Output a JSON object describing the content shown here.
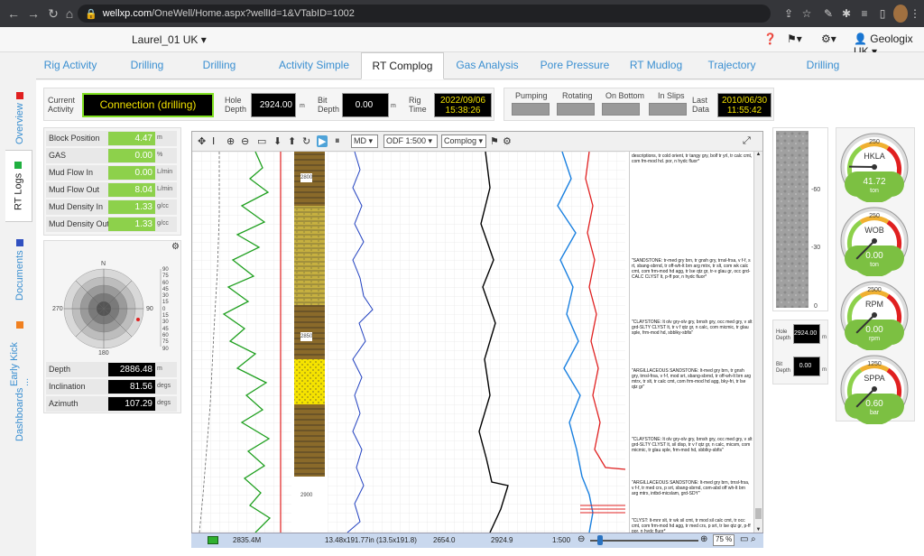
{
  "browser": {
    "url_host": "wellxp.com",
    "url_path": "/OneWell/Home.aspx?wellId=1&VTabID=1002"
  },
  "app": {
    "well_name": "Laurel_01 UK",
    "user": "Geologix UK"
  },
  "tabs": [
    "Rig Activity",
    "Drilling",
    "Drilling Activity",
    "Activity Simple",
    "RT Complog",
    "Gas Analysis",
    "Pore Pressure",
    "RT Mudlog",
    "Trajectory",
    "Drilling Advanced"
  ],
  "active_tab": "RT Complog",
  "sidebar": [
    "Overview",
    "RT Logs",
    "Documents",
    "Early Kick ...",
    "Dashboards"
  ],
  "sidebar_colors": [
    "#e02020",
    "#20b040",
    "#3050c0",
    "#f08020",
    ""
  ],
  "activity": {
    "current_label": "Current Activity",
    "current_value": "Connection (drilling)",
    "hole_depth_label": "Hole Depth",
    "hole_depth": "2924.00",
    "hole_unit": "m",
    "bit_depth_label": "Bit Depth",
    "bit_depth": "0.00",
    "bit_unit": "m",
    "rig_time_label": "Rig Time",
    "rig_date": "2022/09/06",
    "rig_clock": "15:38:26"
  },
  "status_flags": {
    "pumping": "Pumping",
    "rotating": "Rotating",
    "on_bottom": "On Bottom",
    "in_slips": "In Slips",
    "last_data_label": "Last Data",
    "last_date": "2010/06/30",
    "last_clock": "11:55:42"
  },
  "params": [
    {
      "name": "Block Position",
      "value": "4.47",
      "unit": "m"
    },
    {
      "name": "GAS",
      "value": "0.00",
      "unit": "%"
    },
    {
      "name": "Mud Flow In",
      "value": "0.00",
      "unit": "L/min"
    },
    {
      "name": "Mud Flow Out",
      "value": "8.04",
      "unit": "L/min"
    },
    {
      "name": "Mud Density In",
      "value": "1.33",
      "unit": "g/cc"
    },
    {
      "name": "Mud Density Out",
      "value": "1.33",
      "unit": "g/cc"
    }
  ],
  "compass": {
    "n": "N",
    "e": "90",
    "s": "180",
    "w": "270",
    "scale": [
      "90",
      "75",
      "60",
      "45",
      "30",
      "15",
      "0",
      "15",
      "30",
      "45",
      "60",
      "75",
      "90"
    ]
  },
  "direction": [
    {
      "name": "Depth",
      "value": "2886.48",
      "unit": "m"
    },
    {
      "name": "Inclination",
      "value": "81.56",
      "unit": "degs"
    },
    {
      "name": "Azimuth",
      "value": "107.29",
      "unit": "degs"
    }
  ],
  "log_toolbar": {
    "index": "MD",
    "scale": "ODF 1:500",
    "template": "Complog"
  },
  "depth_marks": [
    "2800",
    "2850",
    "2900"
  ],
  "lithology_notes": [
    "descriptions, tr cold orient, tr tangy gry, bolf tr yrl, tr calc cmt, com fm-mod hd. por, n hydc fluor*",
    "\"SANDSTONE: tr-med gry brn, tr gnsh gry, trnsl-frsa, v f-f, s rt, sbang-sbrnd, tr off-wh-lt brn arg mtrx, tr slt, com wk calc cmt, com frm-mod hd agg, tr lse qtz gr, tr-v glau gr, occ grd-CALC CLYST lt, p-ff por, n hydc fluor*",
    "\"CLAYSTONE: lt olv gry-olv gry, brnsh gry, occ med gry, v slt grd-SLTY CLYST lt, tr v f qtz gr, n calc, com micmic, tr glau sple, frm-mod hd, sbblky-sbfis\"",
    "\"ARGILLACEOUS SANDSTONE: lt-med gry brn, tr gnsh gry, trnsl-frsa, v f-f, mod srt, sbang-sbrnd, tr off-wh-lt brn arg mtrx, tr slt, tr calc cmt, com frm-mod hd agg, bky-fri, tr lse qtz gr\"",
    "\"CLAYSTONE: lt olv gry-olv gry, brnsh gry, occ med gry, v slt grd-SLTY CLYST lt, sil disp, tr v f qtz gr, n calc, micsm, com micmic, tr glau sple, frm-mod hd, sbblky-sbfis\"",
    "\"ARGILLACEOUS SANDSTONE: lt-med gry brn, trnsl-frsa, v f-f, tr med crs, p srt, sbang-sbrnd, com-abd off wh-lt brn arg mtrx, intbd-micslam, grd-SDY\"",
    "\"CLYST: lt-mnr slt, tr wk sil cmt, tr mod sil calc cmt, tr occ cmt, com frm-mod hd agg, tr med crs, p srt, tr lse qtz gr, p-ff por, n hydc fluor*"
  ],
  "image_scale": [
    "-60",
    "-30",
    "0"
  ],
  "mini_depth": {
    "hole_label": "Hole Depth",
    "hole": "2924.00",
    "hole_unit": "m",
    "bit_label": "Bit Depth",
    "bit": "0.00",
    "bit_unit": "m"
  },
  "gauges": [
    {
      "name": "HKLA",
      "max": "250",
      "value": "41.72",
      "unit": "ton",
      "level": 0.17
    },
    {
      "name": "WOB",
      "max": "250",
      "value": "0.00",
      "unit": "ton",
      "level": 0.0
    },
    {
      "name": "RPM",
      "max": "2500",
      "value": "0.00",
      "unit": "rpm",
      "level": 0.0
    },
    {
      "name": "SPPA",
      "max": "1250",
      "value": "0.60",
      "unit": "bar",
      "level": 0.0
    }
  ],
  "statusbar": {
    "depth": "2835.4M",
    "view": "13.48x191.77in (13.5x191.8)",
    "top": "2654.0",
    "bottom": "2924.9",
    "scale": "1:500",
    "zoom": "75 %"
  }
}
